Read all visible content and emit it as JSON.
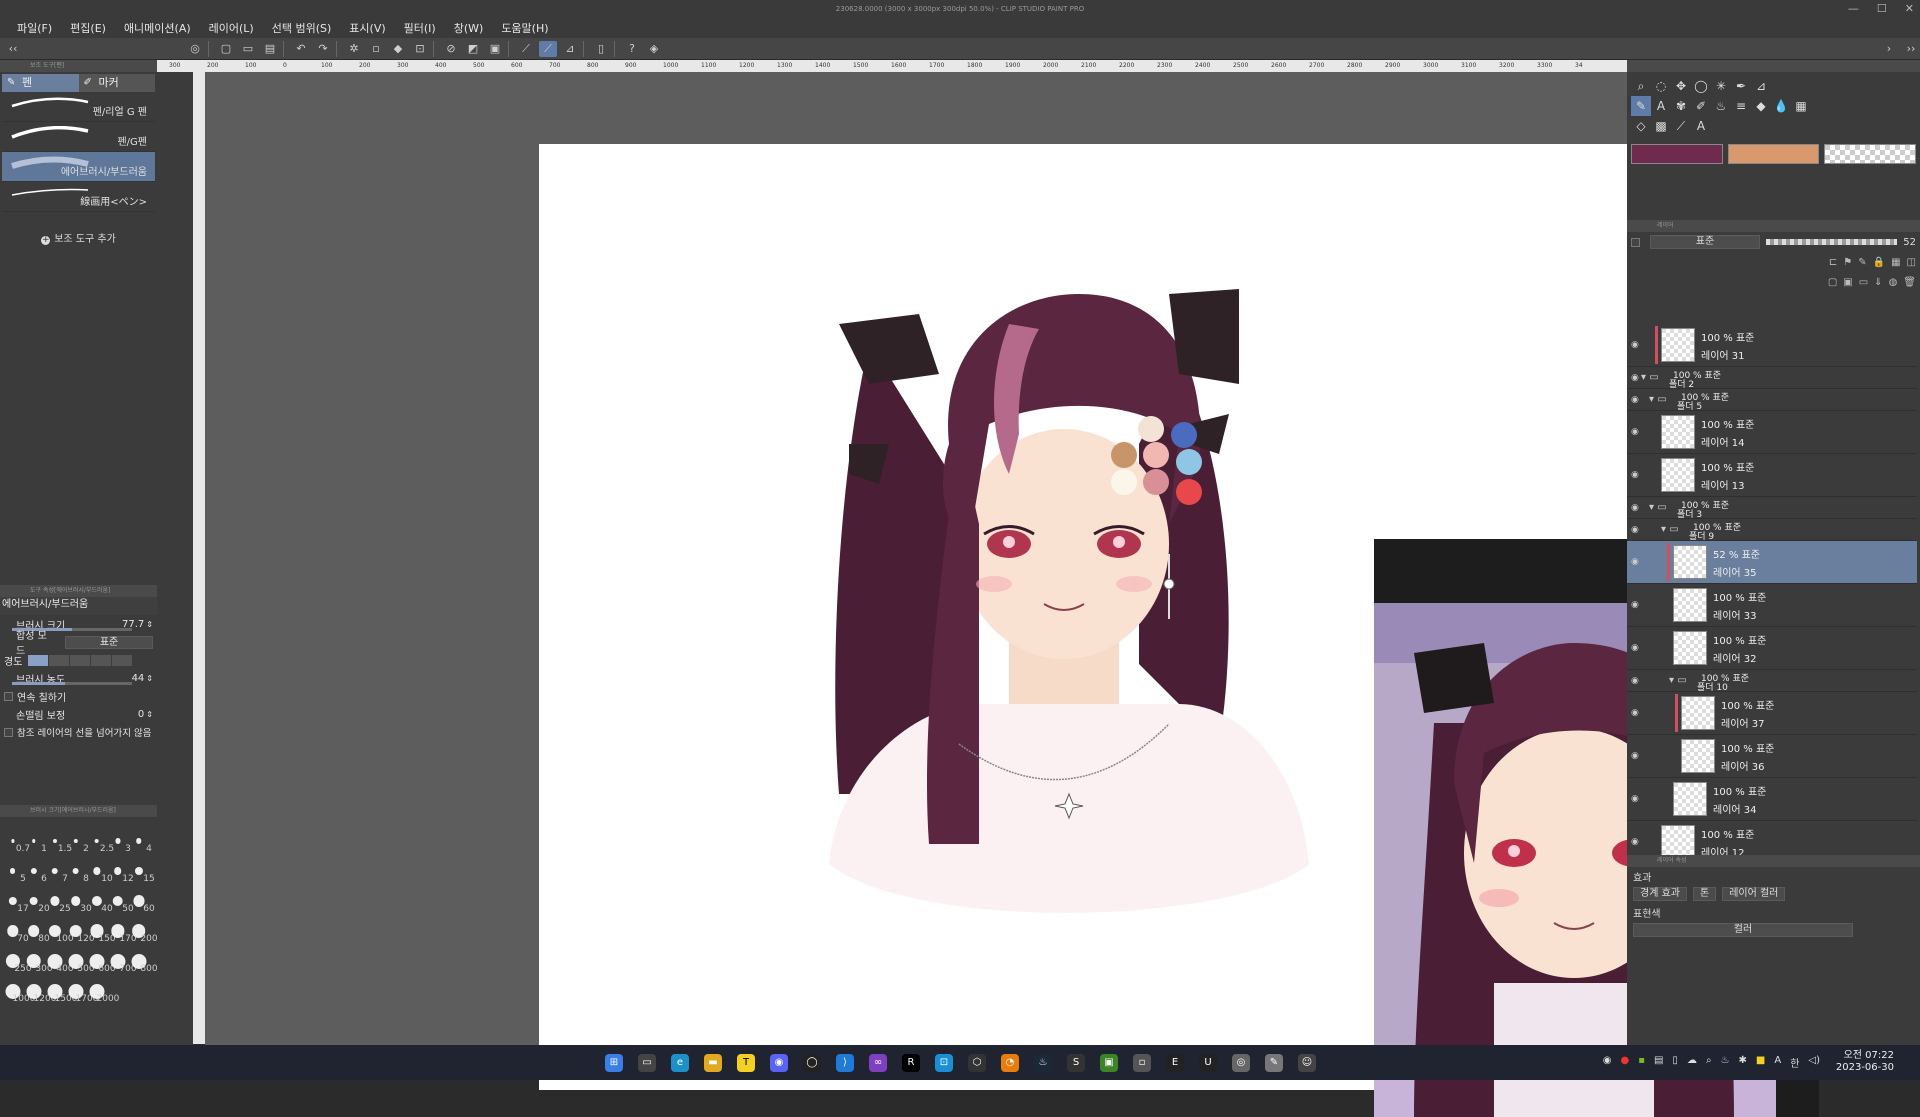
{
  "window": {
    "title": "230628.0000 (3000 x 3000px 300dpi 50.0%) - CLIP STUDIO PAINT PRO",
    "controls": [
      "—",
      "☐",
      "✕"
    ]
  },
  "menu": [
    "파일(F)",
    "편집(E)",
    "애니메이션(A)",
    "레이어(L)",
    "선택 범위(S)",
    "표시(V)",
    "필터(I)",
    "창(W)",
    "도움말(H)"
  ],
  "ruler_labels": [
    "300",
    "200",
    "100",
    "0",
    "100",
    "200",
    "300",
    "400",
    "500",
    "600",
    "700",
    "800",
    "900",
    "1000",
    "1100",
    "1200",
    "1300",
    "1400",
    "1500",
    "1600",
    "1700",
    "1800",
    "1900",
    "2000",
    "2100",
    "2200",
    "2300",
    "2400",
    "2500",
    "2600",
    "2700",
    "2800",
    "2900",
    "3000",
    "3100",
    "3200",
    "3300",
    "34"
  ],
  "subtool": {
    "header": "보조 도구[펜]",
    "tabs": [
      {
        "label": "펜",
        "icon": "pen"
      },
      {
        "label": "마커",
        "icon": "marker"
      }
    ],
    "brushes": [
      {
        "label": "펜/리얼 G 펜"
      },
      {
        "label": "펜/G펜"
      },
      {
        "label": "에어브러시/부드러움"
      },
      {
        "label": "線画用<ペン>"
      }
    ],
    "add_label": "보조 도구 추가"
  },
  "tool_property": {
    "header": "도구 속성[에어브러시/부드러움]",
    "title": "에어브러시/부드러움",
    "brush_size_label": "브러시 크기",
    "brush_size_value": "77.7",
    "blend_mode_label": "합성 모드",
    "blend_mode_value": "표준",
    "hardness_label": "경도",
    "density_label": "브러시 농도",
    "density_value": "44",
    "continuous_label": "연속 칠하기",
    "stabilization_label": "손떨림 보정",
    "stabilization_value": "0",
    "ref_layer_label": "참조 레이어의 선을 넘어가지 않음"
  },
  "brush_sizes": {
    "header": "브러시 크기[에어브러시/부드러움]",
    "sizes": [
      "0.7",
      "1",
      "1.5",
      "2",
      "2.5",
      "3",
      "4",
      "5",
      "6",
      "7",
      "8",
      "10",
      "12",
      "15",
      "17",
      "20",
      "25",
      "30",
      "40",
      "50",
      "60",
      "70",
      "80",
      "100",
      "120",
      "150",
      "170",
      "200",
      "250",
      "300",
      "400",
      "500",
      "600",
      "700",
      "800",
      "1000",
      "1200",
      "1500",
      "1700",
      "2000"
    ]
  },
  "colors": {
    "main": "#6e2b4e",
    "sub": "#d9996c",
    "accent_blue": "#5f7ca8"
  },
  "layers": {
    "header": "레이어",
    "blend_mode": "표준",
    "opacity": "52",
    "items": [
      {
        "mode": "100 % 표준",
        "name": "레이어 31",
        "type": "layer"
      },
      {
        "mode": "100 % 표준",
        "name": "폴더 2",
        "type": "folder"
      },
      {
        "mode": "100 % 표준",
        "name": "폴더 5",
        "type": "folder"
      },
      {
        "mode": "100 % 표준",
        "name": "레이어 14",
        "type": "layer"
      },
      {
        "mode": "100 % 표준",
        "name": "레이어 13",
        "type": "layer"
      },
      {
        "mode": "100 % 표준",
        "name": "폴더 3",
        "type": "folder"
      },
      {
        "mode": "100 % 표준",
        "name": "폴더 9",
        "type": "folder"
      },
      {
        "mode": "52 % 표준",
        "name": "레이어 35",
        "type": "layer"
      },
      {
        "mode": "100 % 표준",
        "name": "레이어 33",
        "type": "layer"
      },
      {
        "mode": "100 % 표준",
        "name": "레이어 32",
        "type": "layer"
      },
      {
        "mode": "100 % 표준",
        "name": "폴더 10",
        "type": "folder"
      },
      {
        "mode": "100 % 표준",
        "name": "레이어 37",
        "type": "layer"
      },
      {
        "mode": "100 % 표준",
        "name": "레이어 36",
        "type": "layer"
      },
      {
        "mode": "100 % 표준",
        "name": "레이어 34",
        "type": "layer"
      },
      {
        "mode": "100 % 표준",
        "name": "레이어 12",
        "type": "layer"
      }
    ]
  },
  "layer_property": {
    "header": "레이어 속성",
    "effect_label": "효과",
    "border_effect": "경계 효과",
    "tone": "톤",
    "layer_color": "레이어 컬러",
    "expression_label": "표현색",
    "expression_value": "컬러"
  },
  "palette_colors": [
    "#f4e3d4",
    "#4a6bbf",
    "#c8956b",
    "#f0b8b0",
    "#8fc6e6",
    "#fbf6ea",
    "#d89096",
    "#e8474b"
  ],
  "taskbar": {
    "time": "오전 07:22",
    "date": "2023-06-30",
    "lang": "한"
  }
}
